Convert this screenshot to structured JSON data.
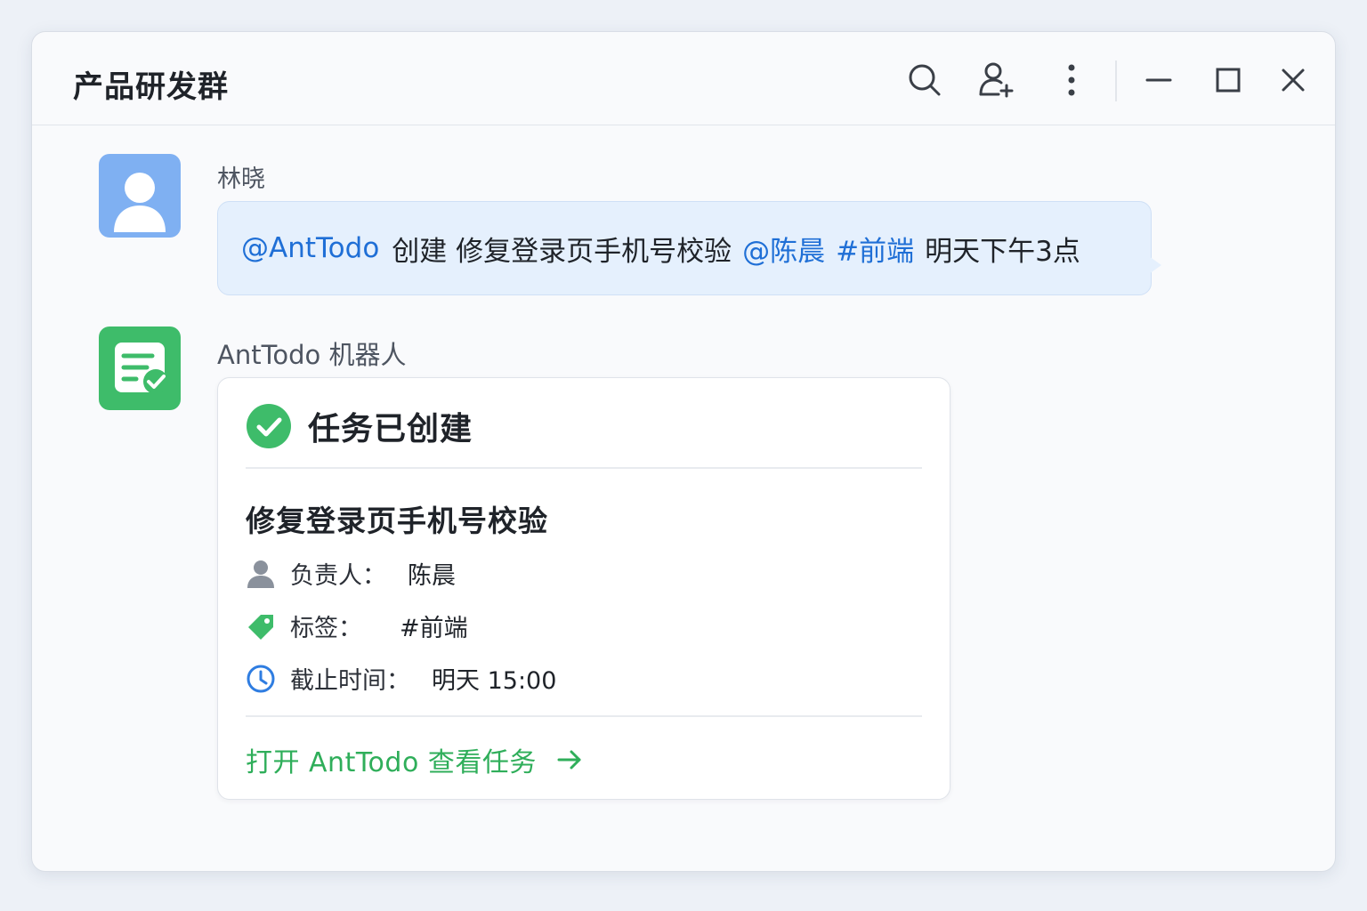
{
  "window": {
    "title": "产品研发群"
  },
  "toolbar": {
    "icons": [
      "search-icon",
      "add-member-icon",
      "more-vertical-icon",
      "minimize-icon",
      "maximize-icon",
      "close-icon"
    ]
  },
  "messages": [
    {
      "sender": "林晓",
      "avatar_icon": "user-icon",
      "avatar_color": "#7fb0f2",
      "parts": {
        "mention_bot": "@AntTodo",
        "text1": "创建 修复登录页手机号校验",
        "mention_user": "@陈晨",
        "hashtag": "#前端",
        "text2": "明天下午3点"
      }
    },
    {
      "sender": "AntTodo 机器人",
      "avatar_icon": "task-check-icon",
      "avatar_color": "#3ebc6a"
    }
  ],
  "card": {
    "status_title": "任务已创建",
    "task_title": "修复登录页手机号校验",
    "assignee_label": "负责人：",
    "assignee_value": "陈晨",
    "tag_label": "标签：",
    "tag_value": "#前端",
    "deadline_label": "截止时间：",
    "deadline_value": "明天 15:00",
    "link_text": "打开 AntTodo 查看任务"
  },
  "colors": {
    "accent_green": "#2fae5a",
    "mention_blue": "#1f6fd6",
    "bubble_bg": "#e5f0fd"
  }
}
